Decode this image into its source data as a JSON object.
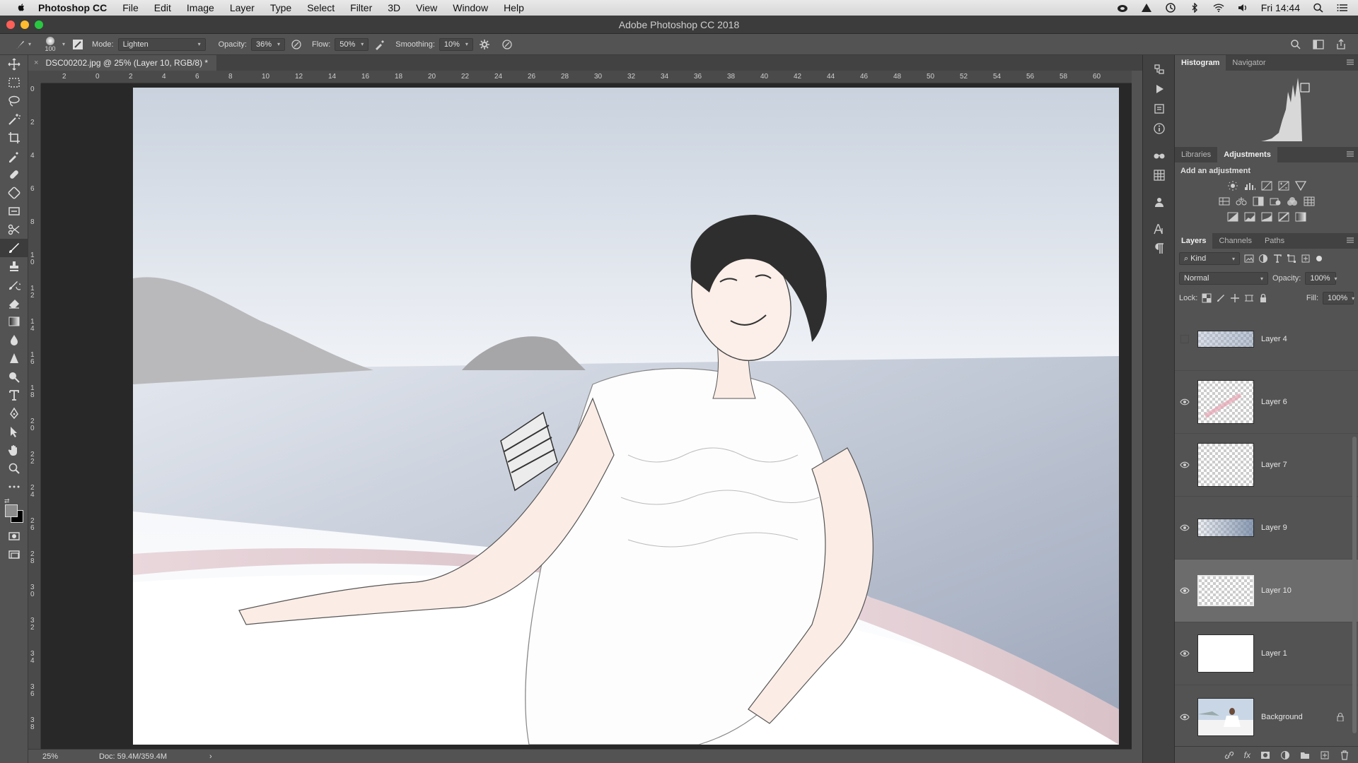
{
  "menubar": {
    "app_name": "Photoshop CC",
    "items": [
      "File",
      "Edit",
      "Image",
      "Layer",
      "Type",
      "Select",
      "Filter",
      "3D",
      "View",
      "Window",
      "Help"
    ],
    "clock": "Fri 14:44"
  },
  "window": {
    "title": "Adobe Photoshop CC 2018"
  },
  "options": {
    "brush_size": "100",
    "mode_label": "Mode:",
    "mode_value": "Lighten",
    "opacity_label": "Opacity:",
    "opacity_value": "36%",
    "flow_label": "Flow:",
    "flow_value": "50%",
    "smoothing_label": "Smoothing:",
    "smoothing_value": "10%"
  },
  "document": {
    "tab_title": "DSC00202.jpg @ 25% (Layer 10, RGB/8) *",
    "close": "×"
  },
  "rulers": {
    "horizontal": [
      "2",
      "0",
      "2",
      "4",
      "6",
      "8",
      "10",
      "12",
      "14",
      "16",
      "18",
      "20",
      "22",
      "24",
      "26",
      "28",
      "30",
      "32",
      "34",
      "36",
      "38",
      "40",
      "42",
      "44",
      "46",
      "48",
      "50",
      "52",
      "54",
      "56",
      "58",
      "60"
    ],
    "vertical": [
      "0",
      "2",
      "4",
      "6",
      "8",
      "10",
      "12",
      "14",
      "16",
      "18",
      "20",
      "22",
      "24",
      "26",
      "28",
      "30",
      "32",
      "34",
      "36",
      "38"
    ]
  },
  "status": {
    "zoom": "25%",
    "doc": "Doc: 59.4M/359.4M",
    "arrow": "›"
  },
  "panels": {
    "top_tabs": [
      "Histogram",
      "Navigator"
    ],
    "mid_tabs": [
      "Libraries",
      "Adjustments"
    ],
    "add_adjustment": "Add an adjustment",
    "layer_tabs": [
      "Layers",
      "Channels",
      "Paths"
    ],
    "kind_filter": "Kind",
    "blend_mode": "Normal",
    "opacity_label": "Opacity:",
    "opacity_value": "100%",
    "lock_label": "Lock:",
    "fill_label": "Fill:",
    "fill_value": "100%"
  },
  "layers": [
    {
      "name": "Layer 4",
      "visible": false,
      "selected": false
    },
    {
      "name": "Layer 6",
      "visible": true,
      "selected": false
    },
    {
      "name": "Layer 7",
      "visible": true,
      "selected": false
    },
    {
      "name": "Layer 9",
      "visible": true,
      "selected": false
    },
    {
      "name": "Layer 10",
      "visible": true,
      "selected": true
    },
    {
      "name": "Layer 1",
      "visible": true,
      "selected": false
    },
    {
      "name": "Background",
      "visible": true,
      "selected": false,
      "locked": true
    }
  ],
  "colors": {
    "accent_red": "#ff5f57",
    "accent_yellow": "#febc2e",
    "accent_green": "#28c840"
  }
}
